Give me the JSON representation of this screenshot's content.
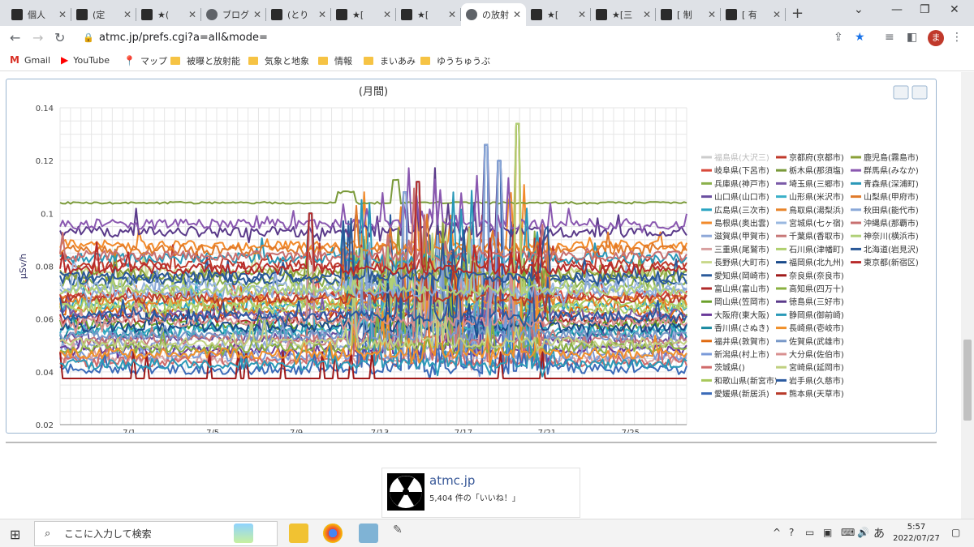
{
  "browser": {
    "tabs": [
      "個人",
      "(定",
      "★(",
      "ブログ",
      "(とり",
      "★[",
      "★[",
      "の放射",
      "★[",
      "★[三",
      "[ 制",
      "[ 有"
    ],
    "active_tab_index": 7,
    "url": "atmc.jp/prefs.cgi?a=all&mode=",
    "avatar_letter": "ま"
  },
  "bookmarks": [
    "Gmail",
    "YouTube",
    "マップ",
    "被曝と放射能",
    "気象と地象",
    "情報",
    "まいあみ",
    "ゆうちゅうぶ"
  ],
  "chart_data": {
    "type": "line",
    "title": "(月間)",
    "ylabel": "μSv/h",
    "ylim": [
      0.02,
      0.14
    ],
    "yticks": [
      "0.02",
      "0.04",
      "0.06",
      "0.08",
      "0.1",
      "0.12",
      "0.14"
    ],
    "xticks": [
      "7/1",
      "7/5",
      "7/9",
      "7/13",
      "7/17",
      "7/21",
      "7/25"
    ],
    "grid": true,
    "legend_position": "right",
    "series": [
      {
        "name": "福島県(大沢三)",
        "color": "#bcbcbc",
        "level": 0.042,
        "disabled": true
      },
      {
        "name": "岐阜県(下呂市)",
        "color": "#d84a3b",
        "level": 0.069
      },
      {
        "name": "兵庫県(神戸市)",
        "color": "#8ab04a",
        "level": 0.074
      },
      {
        "name": "山口県(山口市)",
        "color": "#6a4fa0",
        "level": 0.053
      },
      {
        "name": "広島県(三次市)",
        "color": "#2aa4c2",
        "level": 0.065
      },
      {
        "name": "島根県(奥出雲)",
        "color": "#f28a2a",
        "level": 0.088
      },
      {
        "name": "滋賀県(甲賀市)",
        "color": "#8ea8d8",
        "level": 0.05
      },
      {
        "name": "三重県(尾鷲市)",
        "color": "#d8a0a0",
        "level": 0.045
      },
      {
        "name": "長野県(大町市)",
        "color": "#c8d88a",
        "level": 0.078
      },
      {
        "name": "愛知県(岡崎市)",
        "color": "#2a5a9a",
        "level": 0.075
      },
      {
        "name": "富山県(富山市)",
        "color": "#b02a2a",
        "level": 0.06
      },
      {
        "name": "岡山県(笠岡市)",
        "color": "#6aa02a",
        "level": 0.058
      },
      {
        "name": "大阪府(東大阪)",
        "color": "#6a3a9a",
        "level": 0.048
      },
      {
        "name": "香川県(さぬき)",
        "color": "#1a8aa0",
        "level": 0.055
      },
      {
        "name": "福井県(敦賀市)",
        "color": "#e06a10",
        "level": 0.063
      },
      {
        "name": "新潟県(村上市)",
        "color": "#7a9ad8",
        "level": 0.046
      },
      {
        "name": "茨城県()",
        "color": "#d06a6a",
        "level": 0.044
      },
      {
        "name": "和歌山県(新宮市)",
        "color": "#a8c85a",
        "level": 0.066
      },
      {
        "name": "愛媛県(新居浜)",
        "color": "#3a6ab8",
        "level": 0.041
      },
      {
        "name": "京都府(京都市)",
        "color": "#c0392b",
        "level": 0.081
      },
      {
        "name": "栃木県(那須塩)",
        "color": "#7a9a3a",
        "level": 0.104
      },
      {
        "name": "埼玉県(三郷市)",
        "color": "#7a5aa8",
        "level": 0.062
      },
      {
        "name": "山形県(米沢市)",
        "color": "#3ab0c8",
        "level": 0.056
      },
      {
        "name": "鳥取県(湯梨浜)",
        "color": "#e8842a",
        "level": 0.067
      },
      {
        "name": "宮城県(七ヶ宿)",
        "color": "#9ab8e0",
        "level": 0.072
      },
      {
        "name": "千葉県(香取市)",
        "color": "#c87878",
        "level": 0.052
      },
      {
        "name": "石川県(津幡町)",
        "color": "#b0d070",
        "level": 0.064
      },
      {
        "name": "福岡県(北九州)",
        "color": "#1a4a8a",
        "level": 0.057
      },
      {
        "name": "奈良県(奈良市)",
        "color": "#a01a1a",
        "level": 0.037
      },
      {
        "name": "高知県(四万十)",
        "color": "#8ab040",
        "level": 0.049
      },
      {
        "name": "徳島県(三好市)",
        "color": "#5a3a8a",
        "level": 0.093
      },
      {
        "name": "静岡県(御前崎)",
        "color": "#2a9ab8",
        "level": 0.043
      },
      {
        "name": "長崎県(壱岐市)",
        "color": "#f0902a",
        "level": 0.047
      },
      {
        "name": "佐賀県(武雄市)",
        "color": "#7898c8",
        "level": 0.054
      },
      {
        "name": "大分県(佐伯市)",
        "color": "#d89090",
        "level": 0.059
      },
      {
        "name": "宮崎県(延岡市)",
        "color": "#c0d080",
        "level": 0.051
      },
      {
        "name": "岩手県(久慈市)",
        "color": "#2a5aa0",
        "level": 0.061
      },
      {
        "name": "熊本県(天草市)",
        "color": "#b83a2a",
        "level": 0.068
      },
      {
        "name": "鹿児島(霧島市)",
        "color": "#8aa038",
        "level": 0.077
      },
      {
        "name": "群馬県(みなか)",
        "color": "#8a58b0",
        "level": 0.096
      },
      {
        "name": "青森県(深浦町)",
        "color": "#2a98b8",
        "level": 0.083
      },
      {
        "name": "山梨県(甲府市)",
        "color": "#e07a2a",
        "level": 0.086
      },
      {
        "name": "秋田県(能代市)",
        "color": "#8aa8d8",
        "level": 0.07
      },
      {
        "name": "沖縄県(那覇市)",
        "color": "#c87070",
        "level": 0.084
      },
      {
        "name": "神奈川(横浜市)",
        "color": "#b0d078",
        "level": 0.071
      },
      {
        "name": "北海道(岩見沢)",
        "color": "#2a5898",
        "level": 0.076
      },
      {
        "name": "東京都(新宿区)",
        "color": "#b82a2a",
        "level": 0.079
      }
    ]
  },
  "footer": {
    "fb_name": "atmc.jp",
    "fb_likes": "5,404 件の「いいね！」"
  },
  "taskbar": {
    "search_placeholder": "ここに入力して検索",
    "time": "5:57",
    "date": "2022/07/27",
    "ime": "あ"
  }
}
